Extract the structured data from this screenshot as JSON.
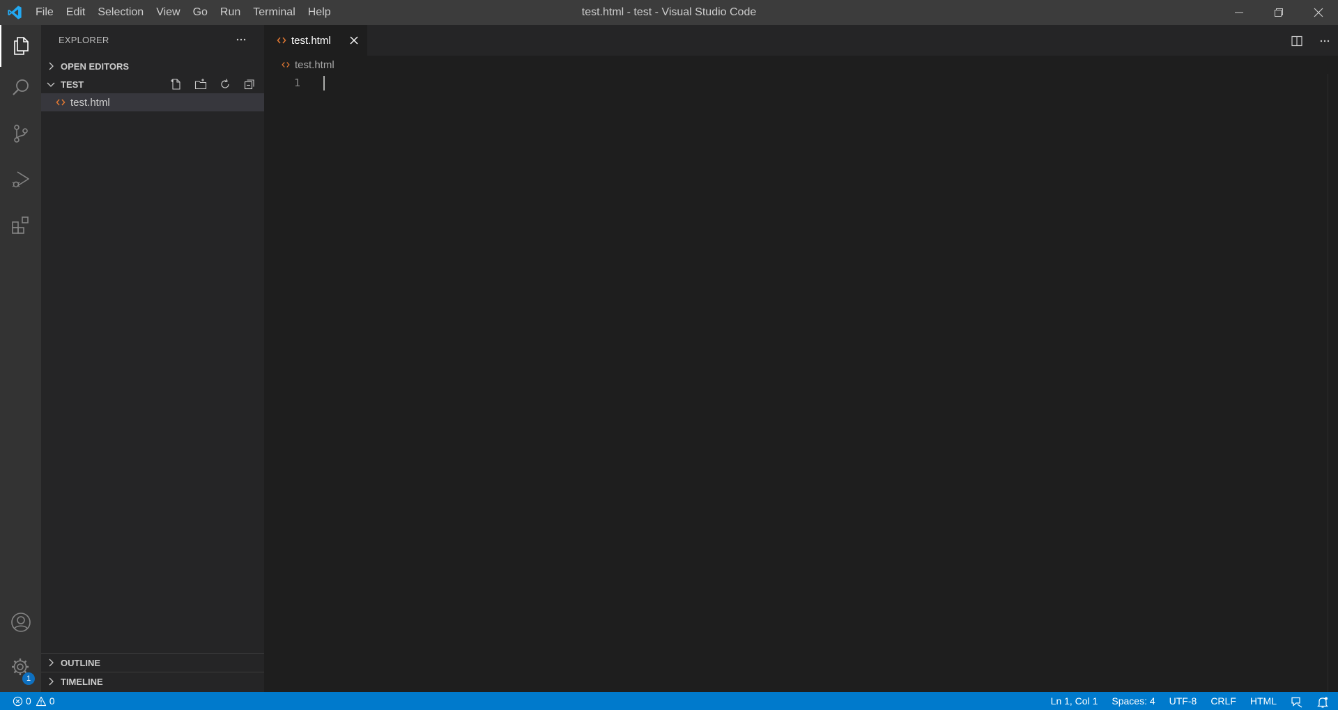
{
  "window": {
    "title": "test.html - test - Visual Studio Code",
    "menu": [
      "File",
      "Edit",
      "Selection",
      "View",
      "Go",
      "Run",
      "Terminal",
      "Help"
    ]
  },
  "activitybar": {
    "items": [
      "explorer-icon",
      "search-icon",
      "source-control-icon",
      "run-debug-icon",
      "extensions-icon"
    ],
    "bottom": [
      "account-icon",
      "settings-gear-icon"
    ],
    "settings_badge": "1"
  },
  "sidebar": {
    "title": "EXPLORER",
    "open_editors": "OPEN EDITORS",
    "folder": "TEST",
    "files": [
      {
        "name": "test.html",
        "icon": "html-file-icon"
      }
    ],
    "outline": "OUTLINE",
    "timeline": "TIMELINE"
  },
  "editor": {
    "tab_label": "test.html",
    "breadcrumb": "test.html",
    "line_numbers": [
      "1"
    ]
  },
  "statusbar": {
    "errors": "0",
    "warnings": "0",
    "position": "Ln 1, Col 1",
    "spaces": "Spaces: 4",
    "encoding": "UTF-8",
    "eol": "CRLF",
    "language": "HTML"
  },
  "colors": {
    "titlebar": "#3c3c3c",
    "activitybar": "#333333",
    "sidebar": "#252526",
    "editor": "#1e1e1e",
    "statusbar": "#007acc",
    "html_icon": "#e37933",
    "vs_blue": "#23a9f2"
  }
}
